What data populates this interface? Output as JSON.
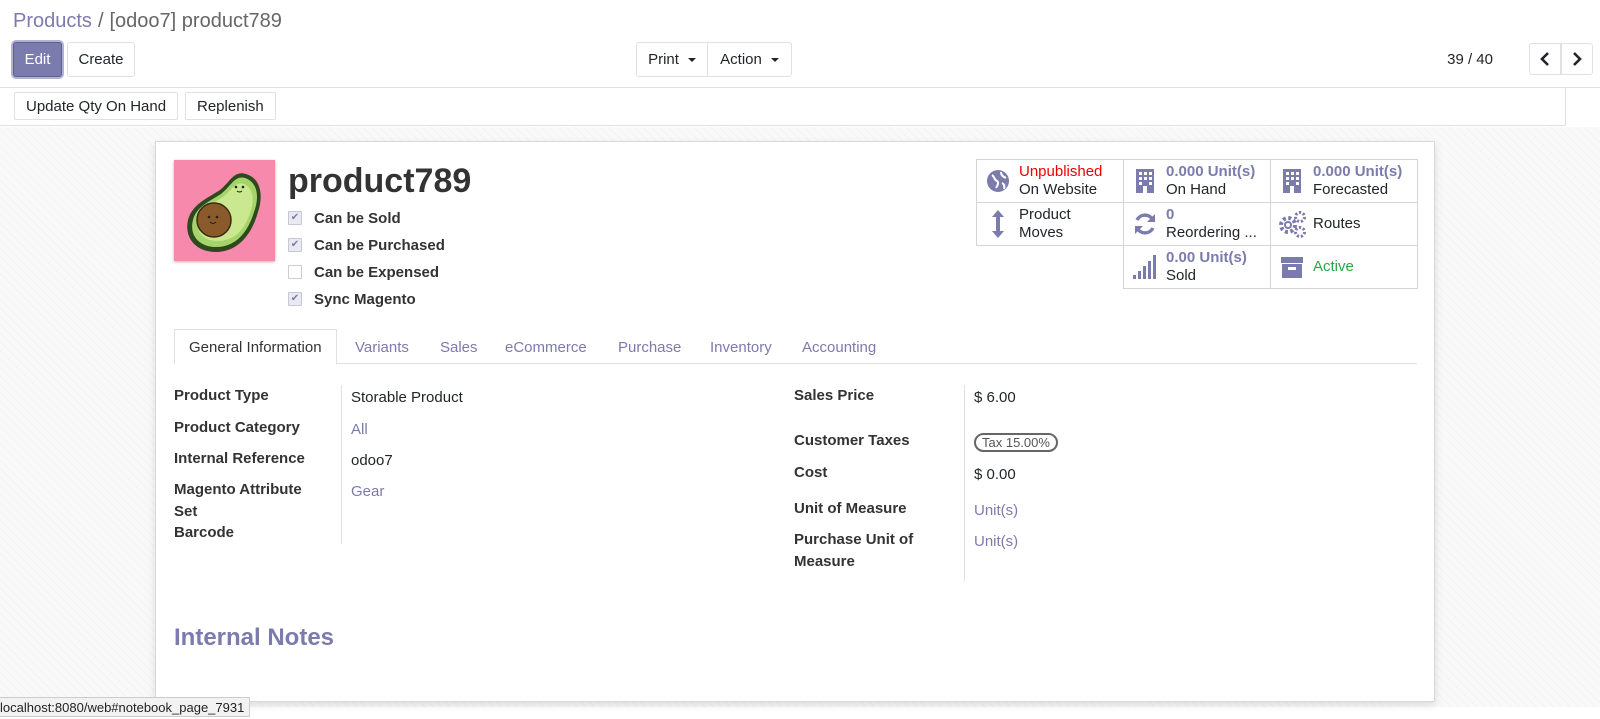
{
  "breadcrumb": {
    "parent": "Products",
    "separator": "/",
    "current": "[odoo7] product789"
  },
  "toolbar": {
    "edit_label": "Edit",
    "create_label": "Create",
    "print_label": "Print",
    "action_label": "Action"
  },
  "pager": {
    "value": "39 / 40"
  },
  "statusbar": {
    "update_qty_label": "Update Qty On Hand",
    "replenish_label": "Replenish"
  },
  "product": {
    "name": "product789",
    "checks": [
      {
        "label": "Can be Sold",
        "checked": true
      },
      {
        "label": "Can be Purchased",
        "checked": true
      },
      {
        "label": "Can be Expensed",
        "checked": false
      },
      {
        "label": "Sync Magento",
        "checked": true
      }
    ]
  },
  "smart_buttons": {
    "website": {
      "status": "Unpublished",
      "label": "On Website"
    },
    "on_hand": {
      "value": "0.000 Unit(s)",
      "label": "On Hand"
    },
    "forecasted": {
      "value": "0.000 Unit(s)",
      "label": "Forecasted"
    },
    "moves": {
      "line1": "Product",
      "line2": "Moves"
    },
    "reordering": {
      "value": "0",
      "label": "Reordering ..."
    },
    "routes": {
      "label": "Routes"
    },
    "sold": {
      "value": "0.00 Unit(s)",
      "label": "Sold"
    },
    "active": {
      "label": "Active"
    }
  },
  "tabs": [
    "General Information",
    "Variants",
    "Sales",
    "eCommerce",
    "Purchase",
    "Inventory",
    "Accounting"
  ],
  "general": {
    "left": {
      "product_type_label": "Product Type",
      "product_type_value": "Storable Product",
      "category_label": "Product Category",
      "category_value": "All",
      "internal_ref_label": "Internal Reference",
      "internal_ref_value": "odoo7",
      "magento_set_label_1": "Magento Attribute",
      "magento_set_label_2": "Set",
      "magento_set_value": "Gear",
      "barcode_label": "Barcode"
    },
    "right": {
      "sales_price_label": "Sales Price",
      "sales_price_value": "$ 6.00",
      "customer_taxes_label": "Customer Taxes",
      "customer_taxes_tag": "Tax 15.00%",
      "cost_label": "Cost",
      "cost_value": "$ 0.00",
      "uom_label": "Unit of Measure",
      "uom_value": "Unit(s)",
      "purchase_uom_label_1": "Purchase Unit of",
      "purchase_uom_label_2": "Measure",
      "purchase_uom_value": "Unit(s)"
    }
  },
  "notes": {
    "title": "Internal Notes"
  },
  "status_url": "localhost:8080/web#notebook_page_7931",
  "colors": {
    "accent": "#7c7bad",
    "unpublished": "#e00000",
    "active": "#28a745"
  }
}
